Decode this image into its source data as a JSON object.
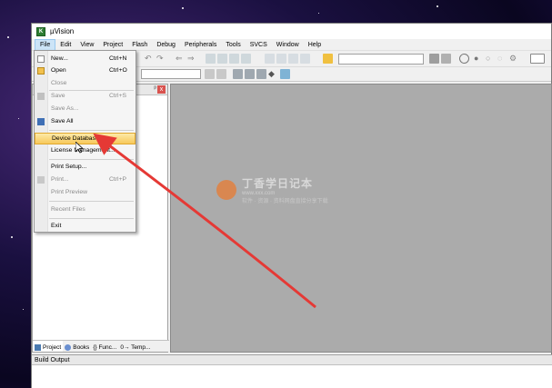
{
  "window": {
    "title": "µVision",
    "app_icon_letter": "K"
  },
  "menubar": {
    "items": [
      "File",
      "Edit",
      "View",
      "Project",
      "Flash",
      "Debug",
      "Peripherals",
      "Tools",
      "SVCS",
      "Window",
      "Help"
    ]
  },
  "file_menu": {
    "items": [
      {
        "label": "New...",
        "shortcut": "Ctrl+N",
        "enabled": true,
        "icon": "new-file-icon"
      },
      {
        "label": "Open",
        "shortcut": "Ctrl+O",
        "enabled": true,
        "icon": "open-folder-icon"
      },
      {
        "label": "Close",
        "shortcut": "",
        "enabled": false,
        "icon": ""
      },
      {
        "label": "Save",
        "shortcut": "Ctrl+S",
        "enabled": false,
        "icon": "save-icon"
      },
      {
        "label": "Save As...",
        "shortcut": "",
        "enabled": false,
        "icon": ""
      },
      {
        "label": "Save All",
        "shortcut": "",
        "enabled": true,
        "icon": "save-all-icon"
      },
      {
        "label": "Device Database...",
        "shortcut": "",
        "enabled": true,
        "icon": "",
        "highlighted": true
      },
      {
        "label": "License Management...",
        "shortcut": "",
        "enabled": true,
        "icon": ""
      },
      {
        "label": "Print Setup...",
        "shortcut": "",
        "enabled": true,
        "icon": ""
      },
      {
        "label": "Print...",
        "shortcut": "Ctrl+P",
        "enabled": false,
        "icon": "print-icon"
      },
      {
        "label": "Print Preview",
        "shortcut": "",
        "enabled": false,
        "icon": ""
      },
      {
        "label": "Recent Files",
        "shortcut": "",
        "enabled": false,
        "icon": ""
      },
      {
        "label": "Exit",
        "shortcut": "",
        "enabled": true,
        "icon": ""
      }
    ]
  },
  "project_panel": {
    "pin_glyph": "ᵖ",
    "close_glyph": "x",
    "tabs": [
      {
        "label": "Project",
        "icon": "project-icon",
        "active": true
      },
      {
        "label": "Books",
        "icon": "books-icon",
        "active": false
      },
      {
        "label": "{} Func...",
        "icon": "functions-icon",
        "active": false
      },
      {
        "label": "0→ Temp...",
        "icon": "templates-icon",
        "active": false
      }
    ]
  },
  "build_output": {
    "title": "Build Output"
  },
  "watermark": {
    "title": "丁香学日记本",
    "url": "www.xxx.com",
    "subtitle": "软件 · 资源 · 资料网盘直接分享下载"
  },
  "colors": {
    "menu_highlight": "#f7c85a",
    "editor_bg": "#ababab",
    "arrow": "#e53935"
  }
}
